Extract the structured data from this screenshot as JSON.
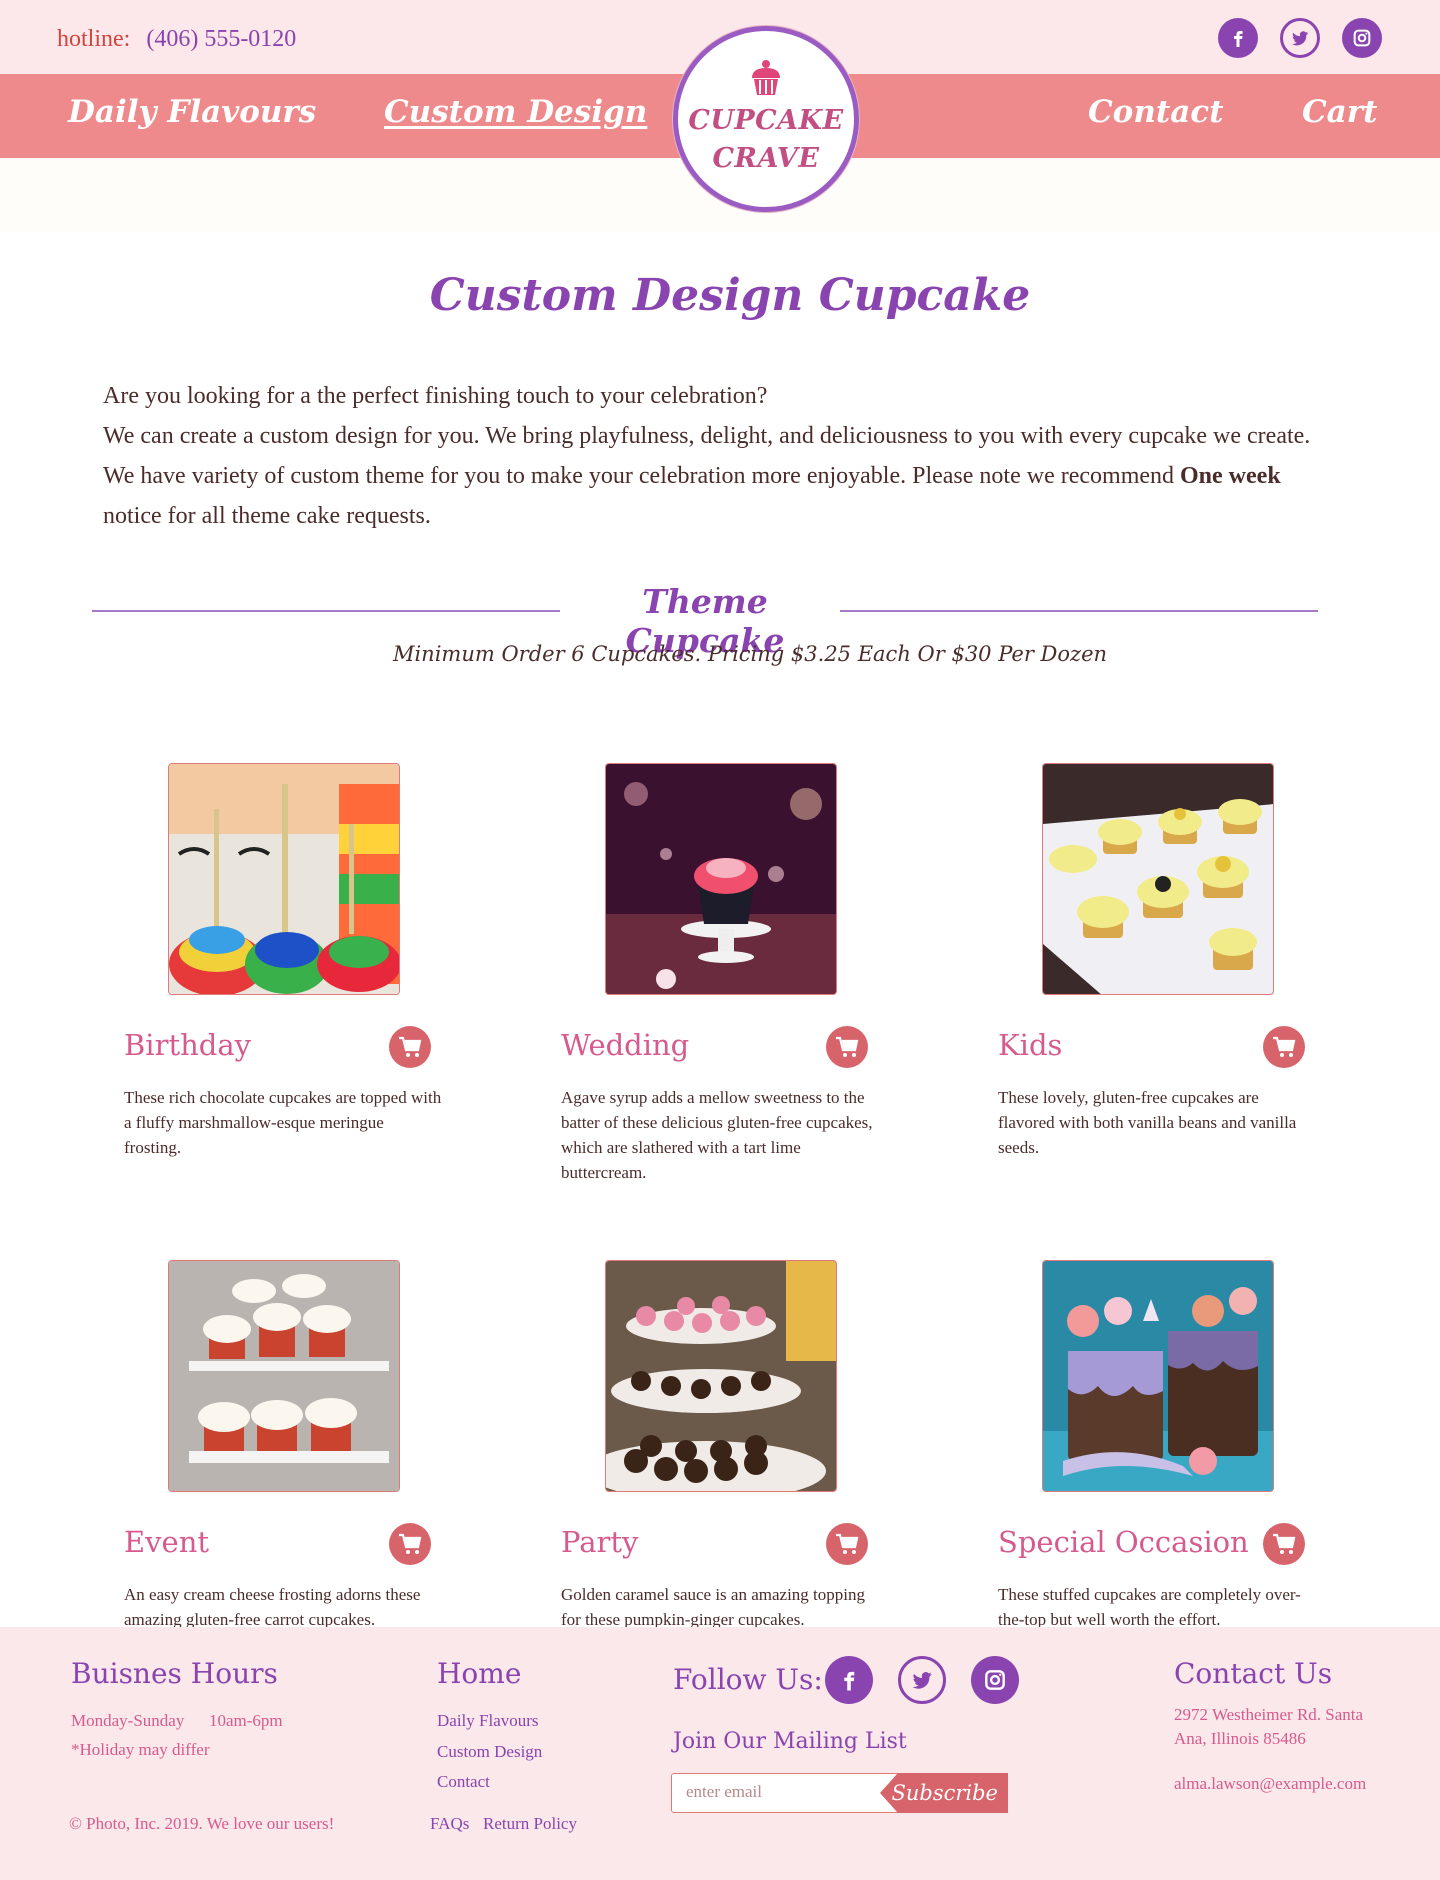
{
  "header": {
    "hotline_label": "hotline:",
    "hotline_number": "(406) 555-0120",
    "social_icons": [
      "facebook-icon",
      "twitter-icon",
      "instagram-icon"
    ]
  },
  "nav": {
    "daily": "Daily Flavours",
    "custom": "Custom Design",
    "contact": "Contact",
    "cart": "Cart"
  },
  "logo": {
    "line1": "CUPCAKE",
    "line2": "CRAVE"
  },
  "hero": {
    "title": "Custom Design Cupcake",
    "line1": "Are you looking for a the perfect finishing touch to your celebration?",
    "line2": "We can create a custom design for you. We bring playfulness, delight, and deliciousness to you with every cupcake we create.",
    "line3_pre": "We have variety of custom theme for you to make your celebration more enjoyable. Please note we recommend ",
    "line3_bold": "One week",
    "line4": "notice for all theme cake requests."
  },
  "section": {
    "title": "Theme Cupcake",
    "subtitle": "Minimum Order 6 Cupcakes. Pricing $3.25 Each Or $30 Per Dozen"
  },
  "products": [
    {
      "name": "Birthday",
      "desc": "These rich chocolate cupcakes are topped with a fluffy marshmallow-esque meringue frosting."
    },
    {
      "name": "Wedding",
      "desc": "Agave syrup adds a mellow sweetness to the batter of these delicious gluten-free cupcakes, which are slathered with a tart lime buttercream."
    },
    {
      "name": "Kids",
      "desc": "These lovely, gluten-free cupcakes are flavored with both vanilla beans and vanilla seeds."
    },
    {
      "name": "Event",
      "desc": "An easy cream cheese frosting adorns these amazing gluten-free carrot cupcakes."
    },
    {
      "name": "Party",
      "desc": "Golden caramel sauce is an amazing topping for these pumpkin-ginger cupcakes."
    },
    {
      "name": "Special Occasion",
      "desc": "These stuffed cupcakes are completely over-the-top but well worth the effort."
    }
  ],
  "footer": {
    "hours_title": "Buisnes Hours",
    "hours_days": "Monday-Sunday",
    "hours_time": "10am-6pm",
    "hours_note": "*Holiday may differ",
    "copyright": "© Photo, Inc. 2019. We love our users!",
    "home_title": "Home",
    "home_links": [
      "Daily Flavours",
      "Custom Design",
      "Contact"
    ],
    "faqs": "FAQs",
    "return_policy": "Return Policy",
    "follow_title": "Follow Us:",
    "mailing_title": "Join Our Mailing List",
    "email_placeholder": "enter email",
    "subscribe": "Subscribe",
    "contact_title": "Contact Us",
    "address_line1": "2972 Westheimer Rd. Santa",
    "address_line2": "Ana, Illinois 85486",
    "email": "alma.lawson@example.com"
  },
  "colors": {
    "brand_purple": "#8a44b0",
    "nav_pink": "#ee8a8b",
    "accent_pink": "#d65a8d",
    "cart_red": "#d8646b",
    "footer_bg": "#fae8ea"
  }
}
